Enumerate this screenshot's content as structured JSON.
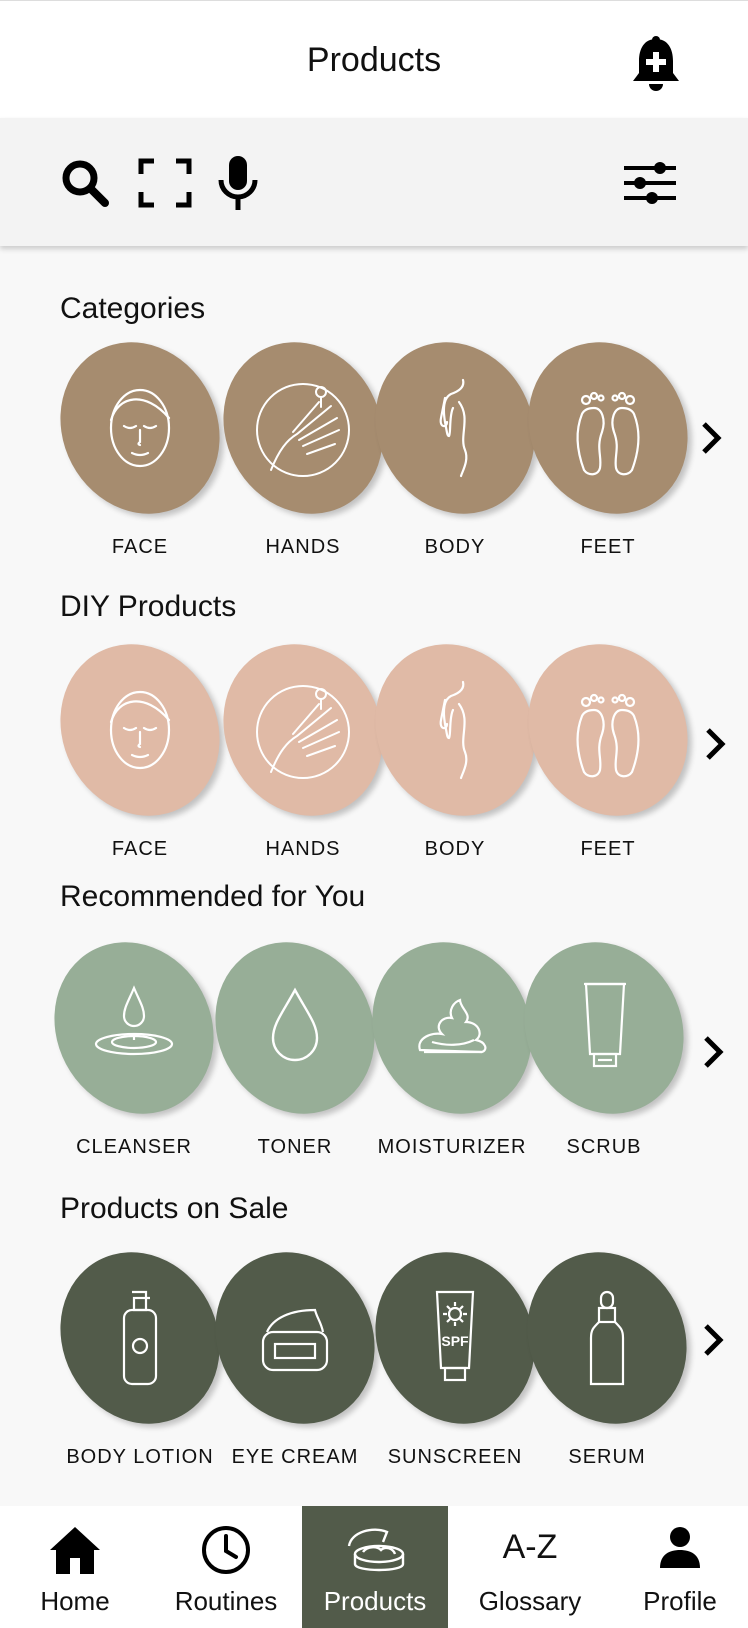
{
  "header": {
    "title": "Products"
  },
  "colors": {
    "categories": "#a68c6f",
    "diy": "#e0baa6",
    "recommended": "#97ae97",
    "sale": "#525b4a",
    "nav_active": "#525b4a"
  },
  "sections": {
    "categories": {
      "title": "Categories",
      "items": [
        {
          "label": "FACE",
          "icon": "face-icon"
        },
        {
          "label": "HANDS",
          "icon": "hand-icon"
        },
        {
          "label": "BODY",
          "icon": "body-icon"
        },
        {
          "label": "FEET",
          "icon": "feet-icon"
        }
      ]
    },
    "diy": {
      "title": "DIY Products",
      "items": [
        {
          "label": "FACE",
          "icon": "face-icon"
        },
        {
          "label": "HANDS",
          "icon": "hand-icon"
        },
        {
          "label": "BODY",
          "icon": "body-icon"
        },
        {
          "label": "FEET",
          "icon": "feet-icon"
        }
      ]
    },
    "recommended": {
      "title": "Recommended for You",
      "items": [
        {
          "label": "CLEANSER",
          "icon": "water-drop-ripple-icon"
        },
        {
          "label": "TONER",
          "icon": "drop-icon"
        },
        {
          "label": "MOISTURIZER",
          "icon": "cream-swirl-icon"
        },
        {
          "label": "SCRUB",
          "icon": "tube-icon"
        }
      ]
    },
    "sale": {
      "title": "Products on Sale",
      "items": [
        {
          "label": "BODY LOTION",
          "icon": "pump-bottle-icon"
        },
        {
          "label": "EYE CREAM",
          "icon": "cream-jar-icon"
        },
        {
          "label": "SUNSCREEN",
          "icon": "sunscreen-tube-icon"
        },
        {
          "label": "SERUM",
          "icon": "dropper-bottle-icon"
        }
      ]
    }
  },
  "sunscreen_badge": "SPF",
  "nav": {
    "items": [
      {
        "label": "Home",
        "icon": "home-icon"
      },
      {
        "label": "Routines",
        "icon": "clock-icon"
      },
      {
        "label": "Products",
        "icon": "cream-jar-icon"
      },
      {
        "label": "Glossary",
        "icon": "a-z-icon",
        "glyph": "A-Z"
      },
      {
        "label": "Profile",
        "icon": "person-icon"
      }
    ],
    "active": "Products"
  }
}
